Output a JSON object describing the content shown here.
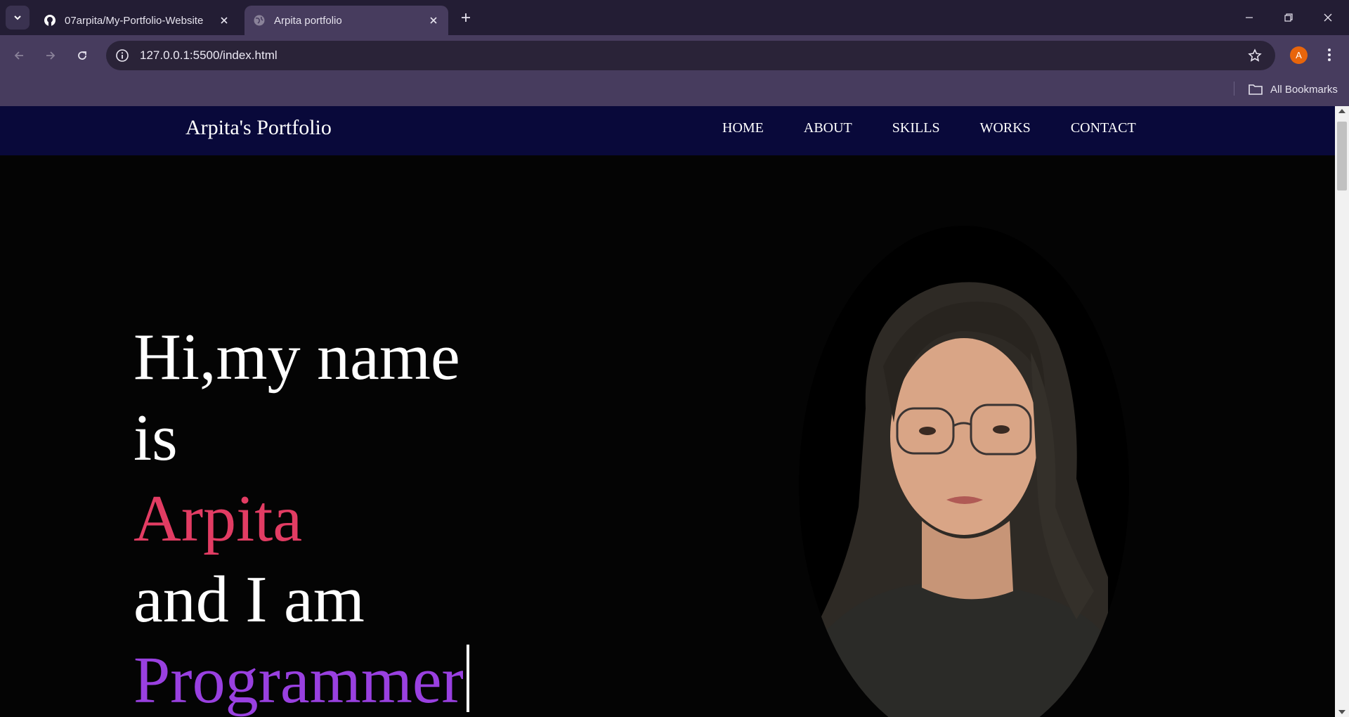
{
  "browser": {
    "tabs": [
      {
        "title": "07arpita/My-Portfolio-Website",
        "icon": "github-icon",
        "active": false
      },
      {
        "title": "Arpita portfolio",
        "icon": "globe-icon",
        "active": true
      }
    ],
    "url": "127.0.0.1:5500/index.html",
    "profile_initial": "A",
    "bookmarks_label": "All Bookmarks"
  },
  "site": {
    "brand": "Arpita's Portfolio",
    "menu": [
      "HOME",
      "ABOUT",
      "SKILLS",
      "WORKS",
      "CONTACT"
    ],
    "hero": {
      "line1": "Hi,my name",
      "line2": "is",
      "name": "Arpita",
      "line4": "and I am",
      "role": "Programmer"
    }
  },
  "colors": {
    "nav_bg": "#09093a",
    "page_bg": "#040404",
    "name_color": "#e23c63",
    "role_color": "#9940e0"
  }
}
